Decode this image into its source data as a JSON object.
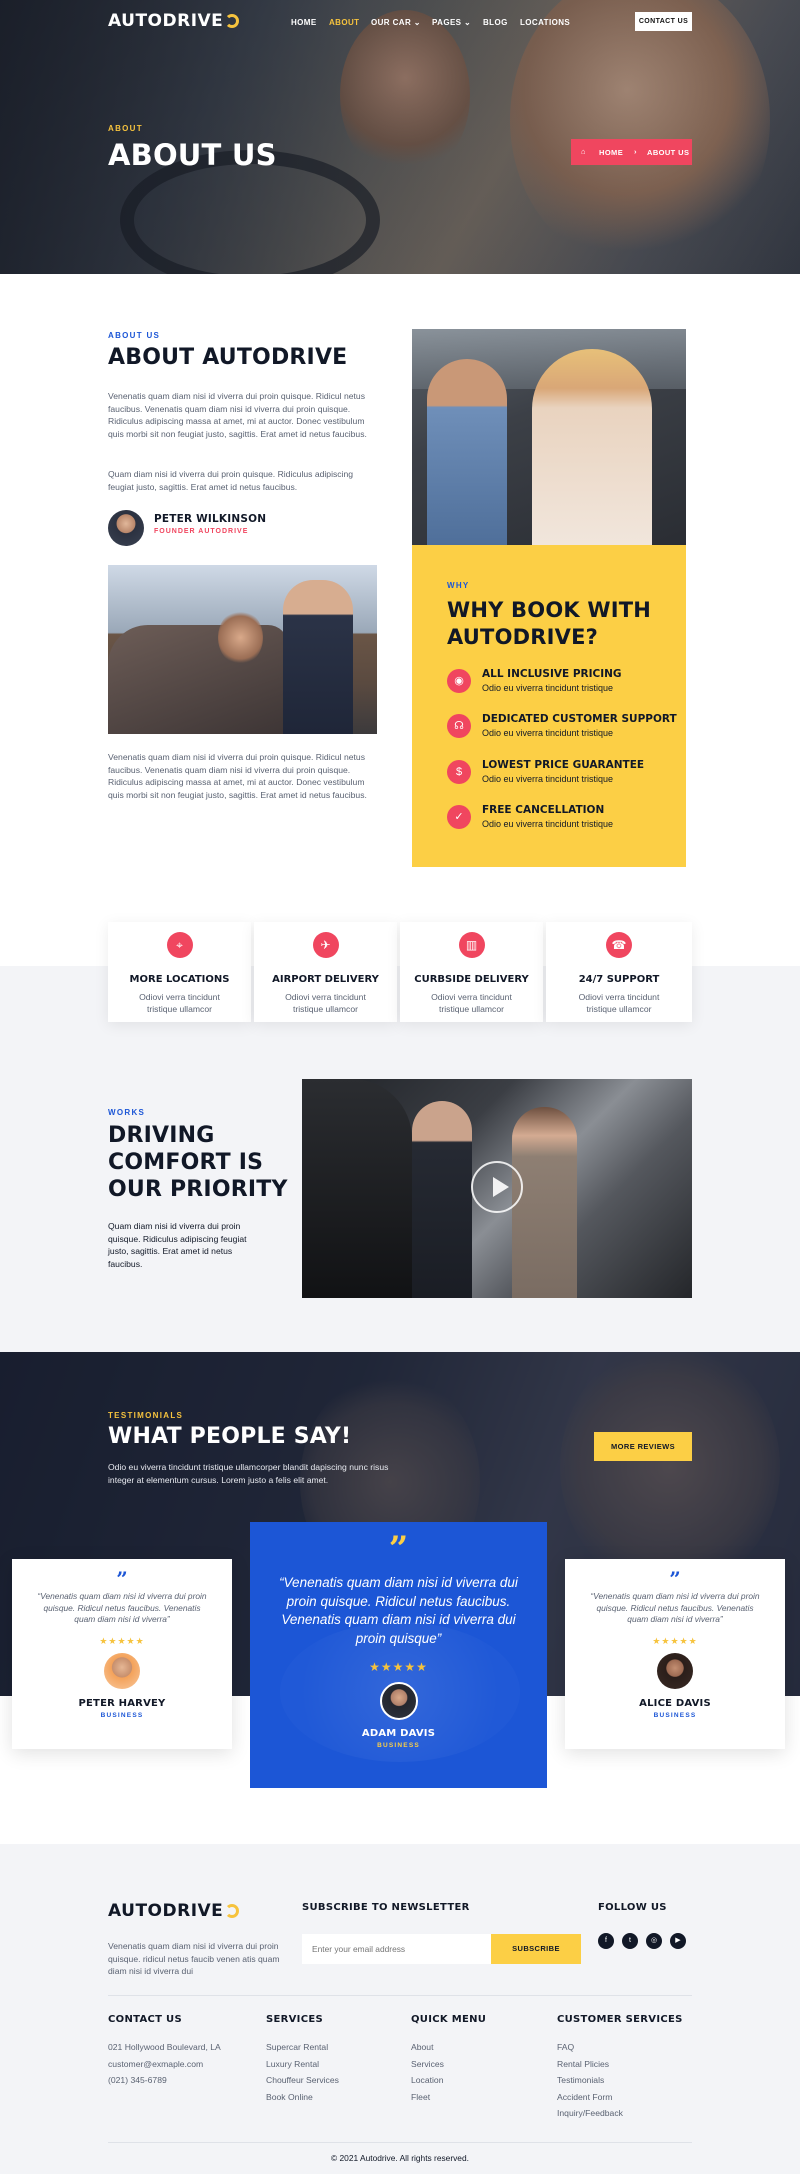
{
  "brand": {
    "name": "AUTODRIVE"
  },
  "nav": {
    "items": [
      "HOME",
      "ABOUT",
      "OUR CAR",
      "PAGES",
      "BLOG",
      "LOCATIONS"
    ],
    "active": "ABOUT",
    "contact_label": "CONTACT US"
  },
  "hero": {
    "kicker": "ABOUT",
    "title": "ABOUT US",
    "breadcrumb_home": "HOME",
    "breadcrumb_current": "ABOUT US"
  },
  "about": {
    "kicker": "ABOUT US",
    "title": "ABOUT AUTODRIVE",
    "para1": "Venenatis quam diam nisi id viverra dui proin quisque. Ridicul netus faucibus. Venenatis quam diam nisi id viverra dui proin quisque. Ridiculus adipiscing massa at amet, mi at auctor. Donec vestibulum quis morbi sit non feugiat justo, sagittis. Erat amet id netus faucibus.",
    "para2": "Quam diam nisi id viverra dui proin quisque. Ridiculus adipiscing feugiat justo, sagittis. Erat amet id netus faucibus.",
    "author_name": "PETER WILKINSON",
    "author_role": "FOUNDER AUTODRIVE",
    "para3": "Venenatis quam diam nisi id viverra dui proin quisque. Ridicul netus faucibus. Venenatis quam diam nisi id viverra dui proin quisque. Ridiculus adipiscing massa at amet, mi at auctor. Donec vestibulum quis morbi sit non feugiat justo, sagittis. Erat amet id netus faucibus."
  },
  "why": {
    "kicker": "WHY",
    "title_line1": "WHY BOOK WITH",
    "title_line2": "AUTODRIVE?",
    "items": [
      {
        "icon": "camera-icon",
        "title": "ALL INCLUSIVE PRICING",
        "sub": "Odio eu viverra tincidunt tristique"
      },
      {
        "icon": "headset-icon",
        "title": "DEDICATED CUSTOMER SUPPORT",
        "sub": "Odio eu viverra tincidunt tristique"
      },
      {
        "icon": "dollar-icon",
        "title": "LOWEST PRICE GUARANTEE",
        "sub": "Odio eu viverra tincidunt tristique"
      },
      {
        "icon": "check-icon",
        "title": "FREE CANCELLATION",
        "sub": "Odio eu viverra tincidunt tristique"
      }
    ]
  },
  "features": [
    {
      "icon": "location-pin-icon",
      "title": "MORE LOCATIONS",
      "line1": "Odiovi verra tincidunt",
      "line2": "tristique ullamcor"
    },
    {
      "icon": "airplane-icon",
      "title": "AIRPORT DELIVERY",
      "line1": "Odiovi verra tincidunt",
      "line2": "tristique ullamcor"
    },
    {
      "icon": "building-icon",
      "title": "CURBSIDE DELIVERY",
      "line1": "Odiovi verra tincidunt",
      "line2": "tristique ullamcor"
    },
    {
      "icon": "support-icon",
      "title": "24/7 SUPPORT",
      "line1": "Odiovi verra tincidunt",
      "line2": "tristique ullamcor"
    }
  ],
  "works": {
    "kicker": "WORKS",
    "title_lines": [
      "DRIVING",
      "COMFORT IS",
      "OUR PRIORITY"
    ],
    "text": "Quam diam nisi id viverra dui proin quisque. Ridiculus adipiscing feugiat justo, sagittis. Erat amet id netus faucibus."
  },
  "testimonials": {
    "kicker": "TESTIMONIALS",
    "title": "WHAT PEOPLE SAY!",
    "intro": "Odio eu viverra tincidunt tristique ullamcorper blandit dapiscing nunc risus integer at elementum cursus. Lorem justo a felis elit amet.",
    "more_label": "MORE REVIEWS",
    "stars": "★★★★★",
    "quote_glyph": "”",
    "left": {
      "quote": "“Venenatis quam diam nisi id viverra dui proin quisque. Ridicul netus faucibus. Venenatis quam diam nisi id viverra”",
      "name": "PETER HARVEY",
      "role": "BUSINESS"
    },
    "center": {
      "quote": "“Venenatis quam diam nisi id viverra dui proin quisque. Ridicul netus faucibus. Venenatis quam diam nisi id viverra dui proin quisque”",
      "name": "ADAM DAVIS",
      "role": "BUSINESS"
    },
    "right": {
      "quote": "“Venenatis quam diam nisi id viverra dui proin quisque. Ridicul netus faucibus. Venenatis quam diam nisi id viverra”",
      "name": "ALICE DAVIS",
      "role": "BUSINESS"
    }
  },
  "footer": {
    "about_text": "Venenatis quam diam nisi id viverra dui proin quisque. ridicul netus faucib venen atis quam diam nisi id viverra dui",
    "newsletter_title": "SUBSCRIBE TO NEWSLETTER",
    "email_placeholder": "Enter your email address",
    "subscribe_label": "SUBSCRIBE",
    "follow_title": "FOLLOW US",
    "contact": {
      "title": "CONTACT US",
      "address": "021 Hollywood Boulevard, LA",
      "email": "customer@exmaple.com",
      "phone": "(021) 345-6789"
    },
    "services": {
      "title": "SERVICES",
      "items": [
        "Supercar Rental",
        "Luxury Rental",
        "Chouffeur Services",
        "Book Online"
      ]
    },
    "quick": {
      "title": "QUICK MENU",
      "items": [
        "About",
        "Services",
        "Location",
        "Fleet"
      ]
    },
    "customer": {
      "title": "CUSTOMER SERVICES",
      "items": [
        "FAQ",
        "Rental Plicies",
        "Testimonials",
        "Accident Form",
        "Inquiry/Feedback"
      ]
    },
    "copyright": "© 2021 Autodrive. All rights reserved."
  },
  "colors": {
    "accent_yellow": "#f6c33e",
    "accent_red": "#f0465f",
    "accent_blue": "#1c56d6",
    "dark": "#111827"
  }
}
